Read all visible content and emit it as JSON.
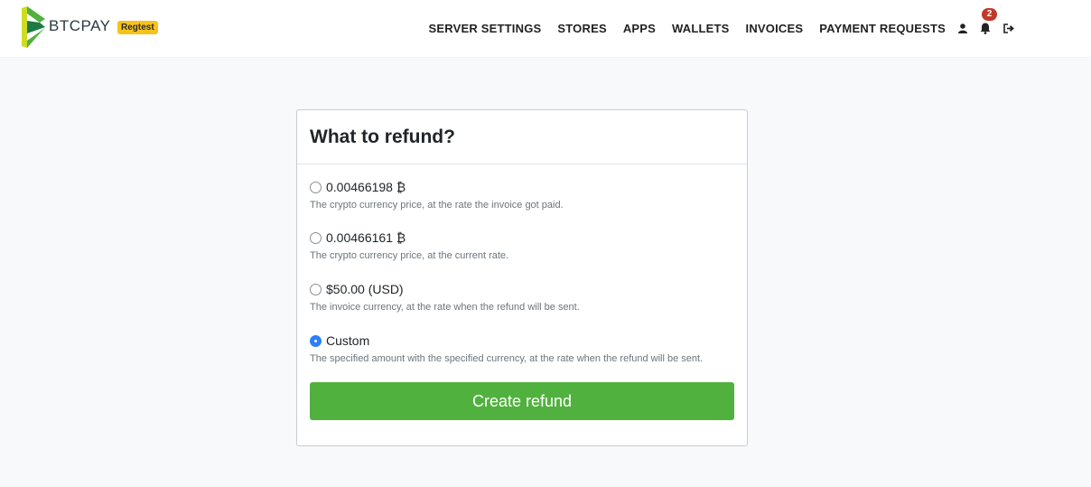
{
  "brand": {
    "name": "BTCPAY",
    "badge": "Regtest"
  },
  "nav": {
    "items": [
      {
        "label": "SERVER SETTINGS"
      },
      {
        "label": "STORES"
      },
      {
        "label": "APPS"
      },
      {
        "label": "WALLETS"
      },
      {
        "label": "INVOICES"
      },
      {
        "label": "PAYMENT REQUESTS"
      }
    ],
    "icons": [
      "user-icon",
      "bell-icon",
      "logout-icon"
    ],
    "notifications_count": "2"
  },
  "refund": {
    "title": "What to refund?",
    "options": [
      {
        "label": "0.00466198 ₿",
        "help": "The crypto currency price, at the rate the invoice got paid.",
        "checked": false
      },
      {
        "label": "0.00466161 ₿",
        "help": "The crypto currency price, at the current rate.",
        "checked": false
      },
      {
        "label": "$50.00 (USD)",
        "help": "The invoice currency, at the rate when the refund will be sent.",
        "checked": false
      },
      {
        "label": "Custom",
        "help": "The specified amount with the specified currency, at the rate when the refund will be sent.",
        "checked": true
      }
    ],
    "submit_label": "Create refund"
  },
  "colors": {
    "accent": "#51b13e",
    "radio_checked": "#2d7ff9",
    "badge": "#f7c31b",
    "notification": "#c0392b"
  }
}
